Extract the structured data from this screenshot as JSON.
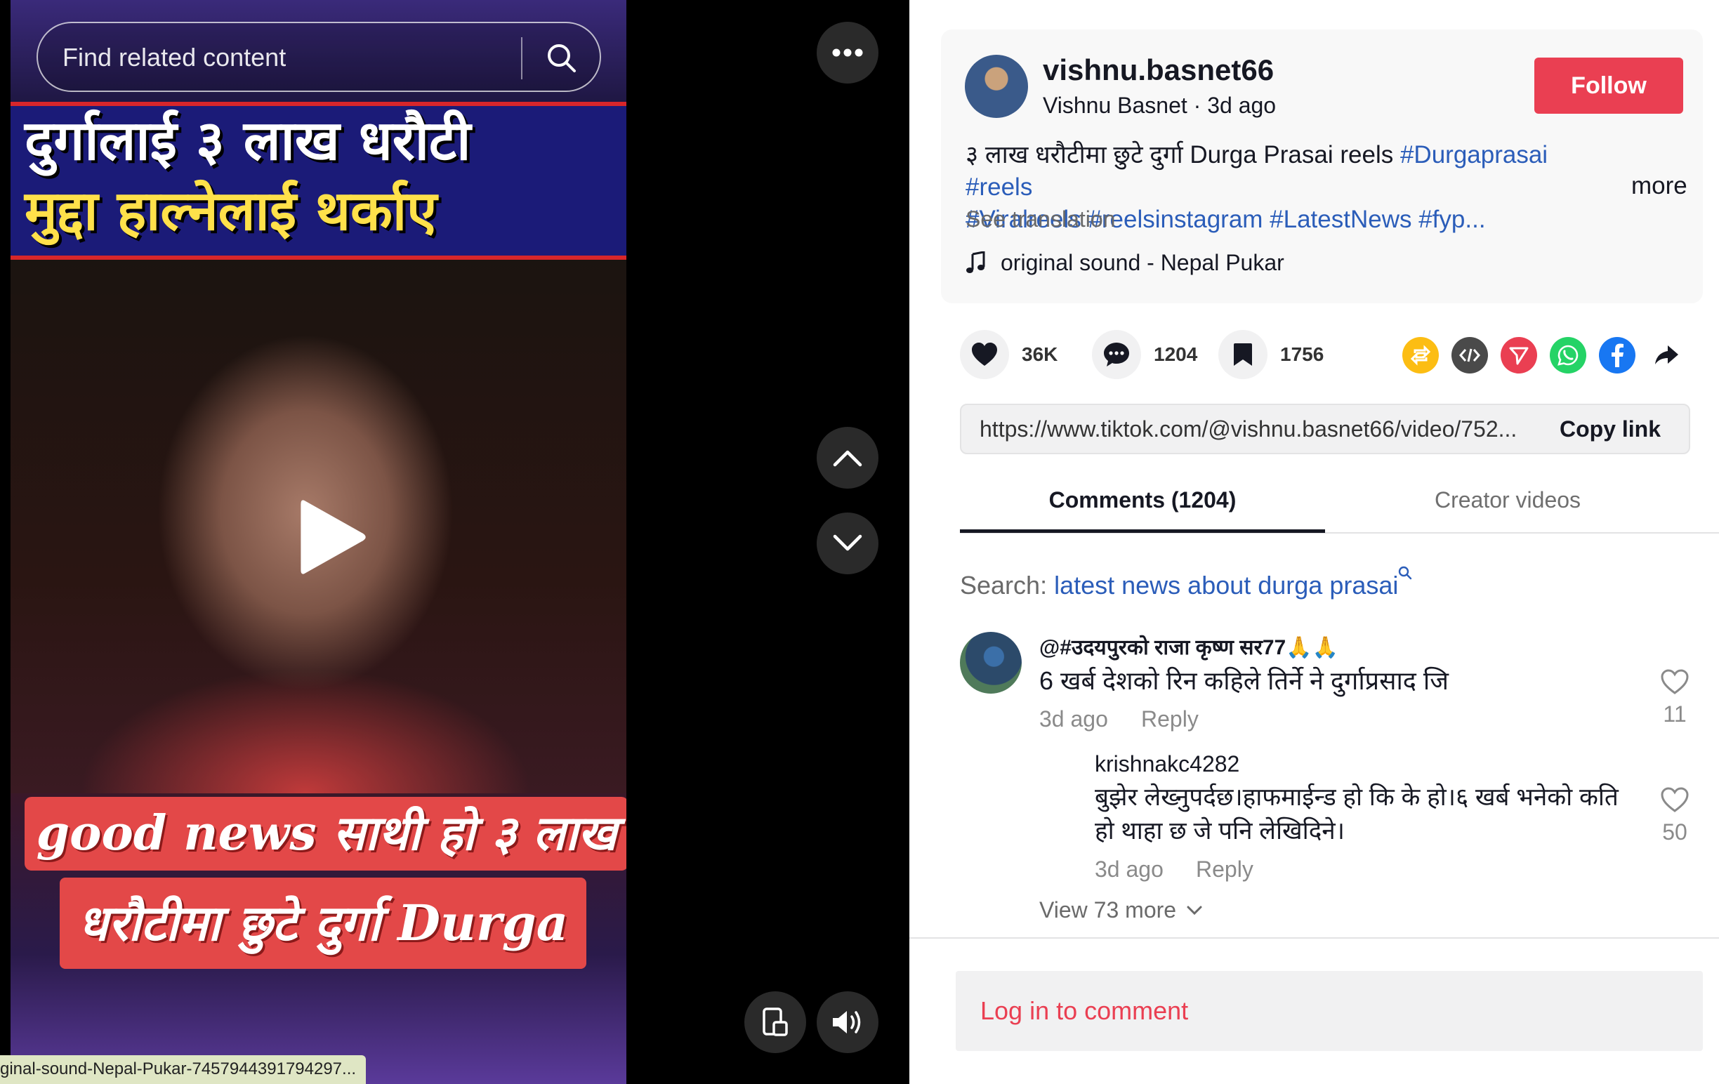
{
  "video": {
    "search_placeholder": "Find related content",
    "headline_line1": "दुर्गालाई ३ लाख धरौटी",
    "headline_line2": "मुद्दा हाल्नेलाई थर्काए",
    "banner_line1": "good news साथी हो ३ लाख",
    "banner_line2": "धरौटीमा छुटे दुर्गा Durga",
    "status_url": "ginal-sound-Nepal-Pukar-7457944391794297..."
  },
  "post": {
    "username": "vishnu.basnet66",
    "nickname_time": "Vishnu Basnet · 3d ago",
    "follow_label": "Follow",
    "caption_plain": "३ लाख धरौटीमा छुटे दुर्गा Durga Prasai reels ",
    "caption_tags_line1": "#Durgaprasai #reels",
    "caption_tags_line2": "#Viralreels #reelsinstagram #LatestNews #fyp...",
    "more_label": "more",
    "see_translation": "See translation",
    "music": "original sound - Nepal Pukar"
  },
  "actions": {
    "likes": "36K",
    "comments": "1204",
    "saves": "1756"
  },
  "share": {
    "icons": [
      "repost-icon",
      "embed-icon",
      "send-icon",
      "whatsapp-icon",
      "facebook-icon",
      "share-arrow-icon"
    ],
    "colors": {
      "repost": "#fcbd13",
      "embed": "#4a4a4a",
      "send": "#ea3f52",
      "whatsapp": "#25d366",
      "facebook": "#1877f2"
    }
  },
  "link": {
    "url": "https://www.tiktok.com/@vishnu.basnet66/video/752...",
    "copy_label": "Copy link"
  },
  "tabs": {
    "comments": "Comments (1204)",
    "creator": "Creator videos"
  },
  "search_suggest": {
    "label": "Search: ",
    "query": "latest news about durga prasai"
  },
  "comments": [
    {
      "user": "@#उदयपुरको राजा कृष्ण सर77🙏🙏",
      "text": "6 खर्ब देशको रिन कहिले तिर्ने ने दुर्गाप्रसाद जि",
      "time": "3d ago",
      "reply": "Reply",
      "likes": "11"
    },
    {
      "user": "krishnakc4282",
      "text": "बुझेर लेख्नुपर्दछ।हाफमाईन्ड हो कि के हो।६ खर्ब भनेको कति हो थाहा छ जे पनि लेखिदिने।",
      "time": "3d ago",
      "reply": "Reply",
      "likes": "50"
    }
  ],
  "view_more": "View 73 more",
  "login": "Log in to comment"
}
